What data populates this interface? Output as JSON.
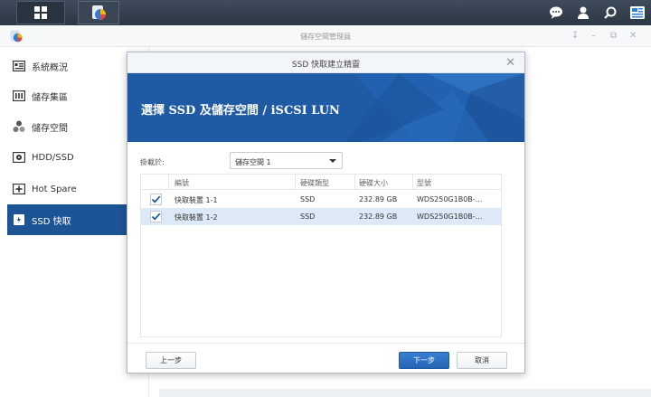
{
  "window": {
    "title": "儲存空間管理員"
  },
  "sidebar": {
    "items": [
      {
        "label": "系統概況",
        "icon": "overview-icon"
      },
      {
        "label": "儲存集區",
        "icon": "storage-pool-icon"
      },
      {
        "label": "儲存空間",
        "icon": "volume-icon"
      },
      {
        "label": "HDD/SSD",
        "icon": "hdd-icon"
      },
      {
        "label": "Hot Spare",
        "icon": "hot-spare-icon"
      },
      {
        "label": "SSD 快取",
        "icon": "ssd-cache-icon",
        "active": true
      }
    ]
  },
  "dialog": {
    "title": "SSD 快取建立精靈",
    "banner_title": "選擇 SSD 及儲存空間 / iSCSI LUN",
    "mount_label": "掛載於:",
    "mount_value": "儲存空間 1",
    "columns": [
      "編號",
      "硬碟類型",
      "硬碟大小",
      "型號"
    ],
    "rows": [
      {
        "checked": true,
        "id": "快取裝置 1-1",
        "type": "SSD",
        "size": "232.89 GB",
        "model": "WDS250G1B0B-...",
        "selected": false
      },
      {
        "checked": true,
        "id": "快取裝置 1-2",
        "type": "SSD",
        "size": "232.89 GB",
        "model": "WDS250G1B0B-...",
        "selected": true
      }
    ],
    "buttons": {
      "back": "上一步",
      "next": "下一步",
      "cancel": "取消"
    }
  },
  "colors": {
    "accent": "#1d5495",
    "banner": "#1f5aa5",
    "selected_row": "#dde9f7"
  }
}
